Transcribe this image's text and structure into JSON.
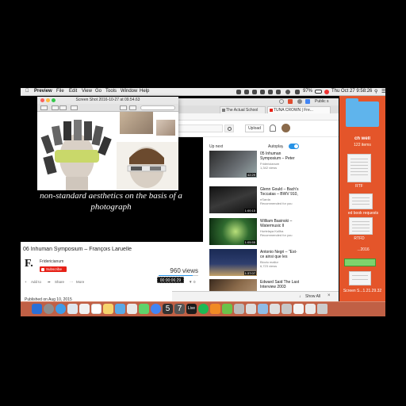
{
  "menubar": {
    "app": "Preview",
    "items": [
      "File",
      "Edit",
      "View",
      "Go",
      "Tools",
      "Window",
      "Help"
    ],
    "battery": "97%",
    "clock": "Thu Oct 27  9:58:26"
  },
  "preview": {
    "title": "Screen Shot 2016-10-27 at 09.54.63"
  },
  "chrome": {
    "tabs": [
      {
        "label": "The Actual School"
      },
      {
        "label": "TUNA CROWN | Fre..."
      }
    ],
    "partial_tab": "Public s"
  },
  "youtube": {
    "upload_label": "Upload",
    "player_caption": "non-standard aesthetics on the basis of a photograph",
    "video_title": "06 Inhuman Symposium – François Laruelle",
    "channel_logo": "F.",
    "channel_name": "Fridericianum",
    "subscribe_label": "Subscribe",
    "views": "960 views",
    "views_fraction": 0.85,
    "timecode": "00:00:06:29",
    "actions": {
      "add": "Add to",
      "share": "Share",
      "more": "More",
      "dislikes": "0"
    },
    "published": "Published on Aug 10, 2015",
    "up_next": "Up next",
    "autoplay": "Autoplay",
    "recommendations": [
      {
        "title": "05 Inhuman Symposium – Peter",
        "channel": "Fridericianum",
        "views": "1,342 views",
        "duration": "42:29"
      },
      {
        "title": "Glenn Gould – Bach's Toccatas – BWV 910,",
        "channel": "nSarda",
        "views": "Recommended for you",
        "duration": "1:00:15"
      },
      {
        "title": "William Basinski – Watermusic II",
        "channel": "Hurtelaya Kullha",
        "views": "Recommended for you",
        "duration": "1:05:55"
      },
      {
        "title": "Antonio Negri – \"Est-ce ainsi que les",
        "channel": "Bloclu mallor",
        "views": "6,723 views",
        "duration": "1:37:07"
      },
      {
        "title": "Edward Said The Last Interview 2003",
        "channel": "Hamzah Talla",
        "views": "35,313 views",
        "duration": "1:57:32"
      }
    ],
    "show_all": "Show All"
  },
  "desktop": {
    "folder_label": "ch well",
    "folder_count": "122 items",
    "file1": "RTF",
    "file2": "ed book requests",
    "file3": "RTFD",
    "file4": "...2016",
    "file5": "Screen S...1.21.29.32"
  }
}
